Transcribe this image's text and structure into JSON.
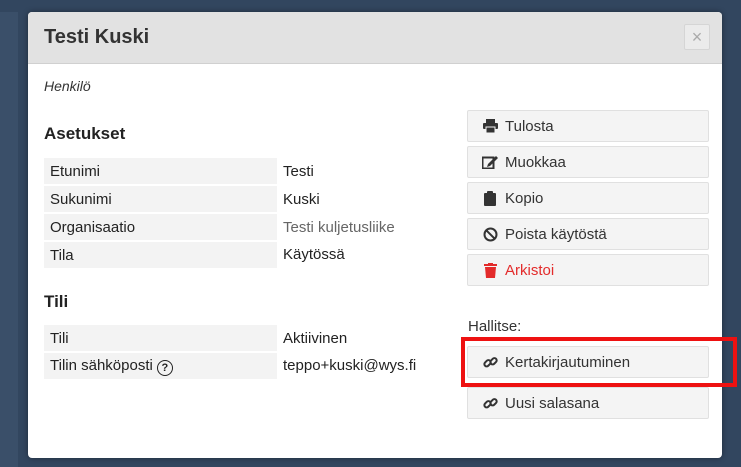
{
  "modal": {
    "title": "Testi Kuski",
    "close_glyph": "×",
    "subtitle": "Henkilö"
  },
  "settings": {
    "heading": "Asetukset",
    "rows": [
      {
        "label": "Etunimi",
        "value": "Testi"
      },
      {
        "label": "Sukunimi",
        "value": "Kuski"
      },
      {
        "label": "Organisaatio",
        "value": "Testi kuljetusliike"
      },
      {
        "label": "Tila",
        "value": "Käytössä"
      }
    ]
  },
  "account": {
    "heading": "Tili",
    "rows": [
      {
        "label": "Tili",
        "value": "Aktiivinen"
      },
      {
        "label": "Tilin sähköposti",
        "value": "teppo+kuski@wys.fi"
      }
    ],
    "help_glyph": "?"
  },
  "actions": {
    "print": "Tulosta",
    "edit": "Muokkaa",
    "copy": "Kopio",
    "disable": "Poista käytöstä",
    "archive": "Arkistoi"
  },
  "manage": {
    "label": "Hallitse:",
    "one_time_login": "Kertakirjautuminen",
    "new_password": "Uusi salasana"
  },
  "colors": {
    "danger": "#e32b2b",
    "highlight": "#ee1111"
  }
}
